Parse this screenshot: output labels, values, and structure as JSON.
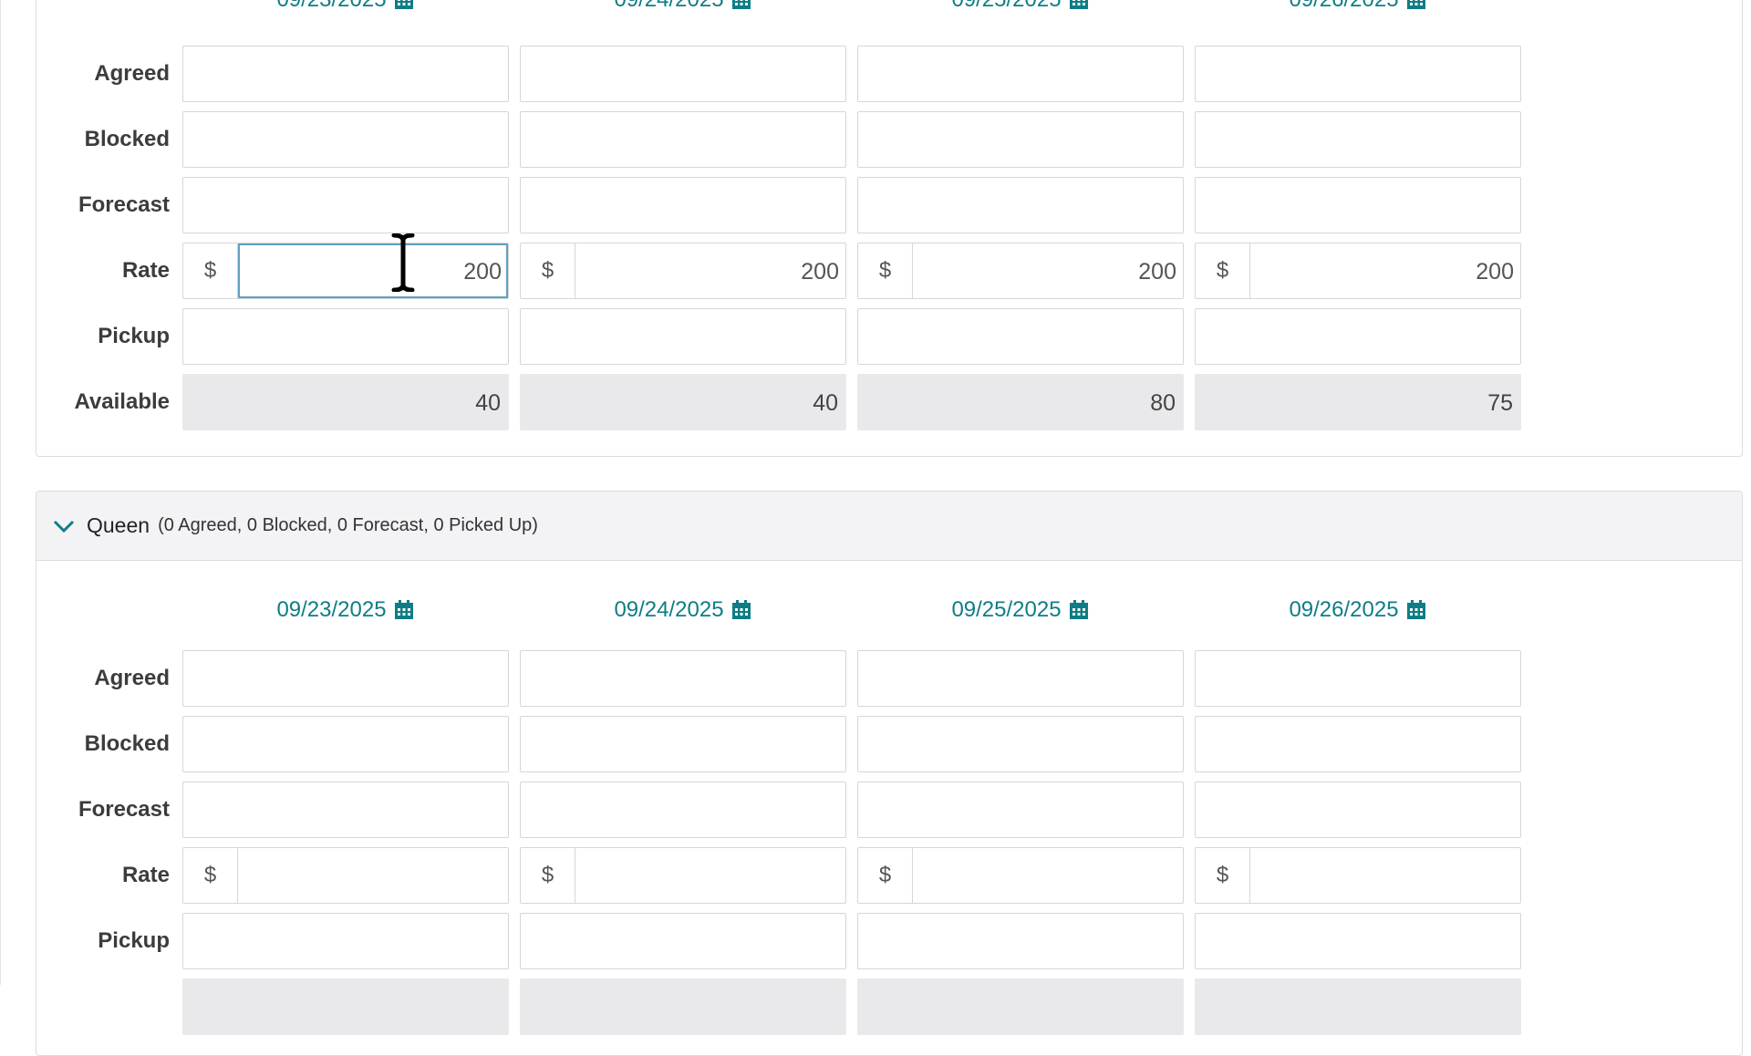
{
  "colors": {
    "accent": "#0f7d86",
    "readonly_bg": "#e9e9ec",
    "header_bg": "#f3f3f5",
    "focus": "#5fa0c3"
  },
  "currency_symbol": "$",
  "row_labels": {
    "agreed": "Agreed",
    "blocked": "Blocked",
    "forecast": "Forecast",
    "rate": "Rate",
    "pickup": "Pickup",
    "available": "Available"
  },
  "dates": [
    "09/23/2025",
    "09/24/2025",
    "09/25/2025",
    "09/26/2025"
  ],
  "section1": {
    "rates": [
      "200",
      "200",
      "200",
      "200"
    ],
    "available": [
      "40",
      "40",
      "80",
      "75"
    ]
  },
  "section2": {
    "title": "Queen",
    "summary": "(0 Agreed, 0 Blocked, 0 Forecast, 0 Picked Up)",
    "rates": [
      "",
      "",
      "",
      ""
    ]
  },
  "icons": {
    "calendar": "calendar-icon",
    "chevron": "chevron-down-icon",
    "cursor": "text-cursor-icon"
  }
}
